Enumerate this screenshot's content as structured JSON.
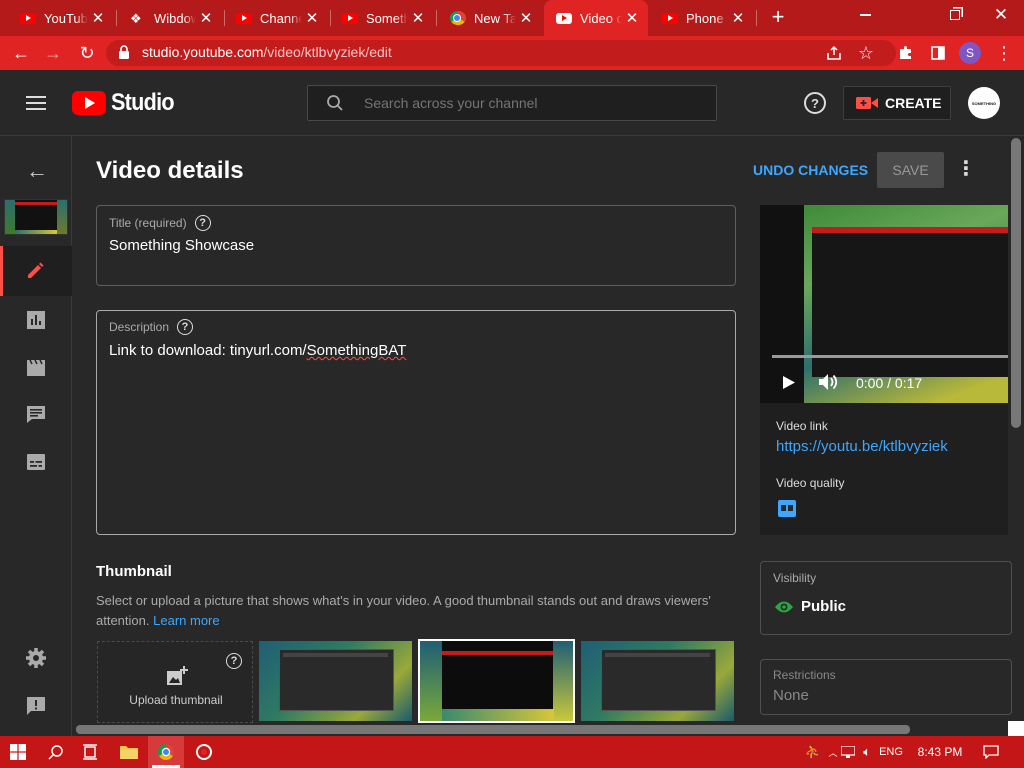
{
  "browser": {
    "tabs": [
      {
        "title": "YouTube",
        "icon": "youtube-icon"
      },
      {
        "title": "Wibdows",
        "icon": "wibdows-icon"
      },
      {
        "title": "Channel",
        "icon": "youtube-icon"
      },
      {
        "title": "Something",
        "icon": "youtube-icon"
      },
      {
        "title": "New Tab",
        "icon": "chrome-icon"
      },
      {
        "title": "Video d",
        "icon": "youtube-white-icon"
      },
      {
        "title": "Phone v",
        "icon": "youtube-icon"
      }
    ],
    "new_tab_symbol": "+",
    "url_domain": "studio.youtube.com",
    "url_path": "/video/ktlbvyziek/edit",
    "profile_initial": "S",
    "colors": {
      "tabstrip": "#b51a1a",
      "toolbar": "#e02323",
      "taskbar": "#c41616"
    }
  },
  "app": {
    "logo_text": "Studio",
    "search_placeholder": "Search across your channel",
    "create_label": "CREATE",
    "channel_avatar_text": "SOMETHING"
  },
  "page": {
    "title": "Video details",
    "undo_label": "UNDO CHANGES",
    "save_label": "SAVE",
    "title_field": {
      "label": "Title (required)",
      "value": "Something Showcase"
    },
    "description_field": {
      "label": "Description",
      "value_prefix": "Link to download: tinyurl.com/",
      "value_misspelled": "SomethingBAT"
    },
    "thumbnail": {
      "heading": "Thumbnail",
      "description": "Select or upload a picture that shows what's in your video. A good thumbnail stands out and draws viewers' attention.",
      "learn_more": "Learn more",
      "upload_label": "Upload thumbnail"
    }
  },
  "preview": {
    "time": "0:00 / 0:17",
    "video_link_label": "Video link",
    "video_link": "https://youtu.be/ktlbvyziek",
    "video_quality_label": "Video quality",
    "quality_badge": "SD"
  },
  "visibility": {
    "label": "Visibility",
    "value": "Public"
  },
  "restrictions": {
    "label": "Restrictions",
    "value": "None"
  },
  "taskbar": {
    "language": "ENG",
    "time": "8:43 PM"
  }
}
